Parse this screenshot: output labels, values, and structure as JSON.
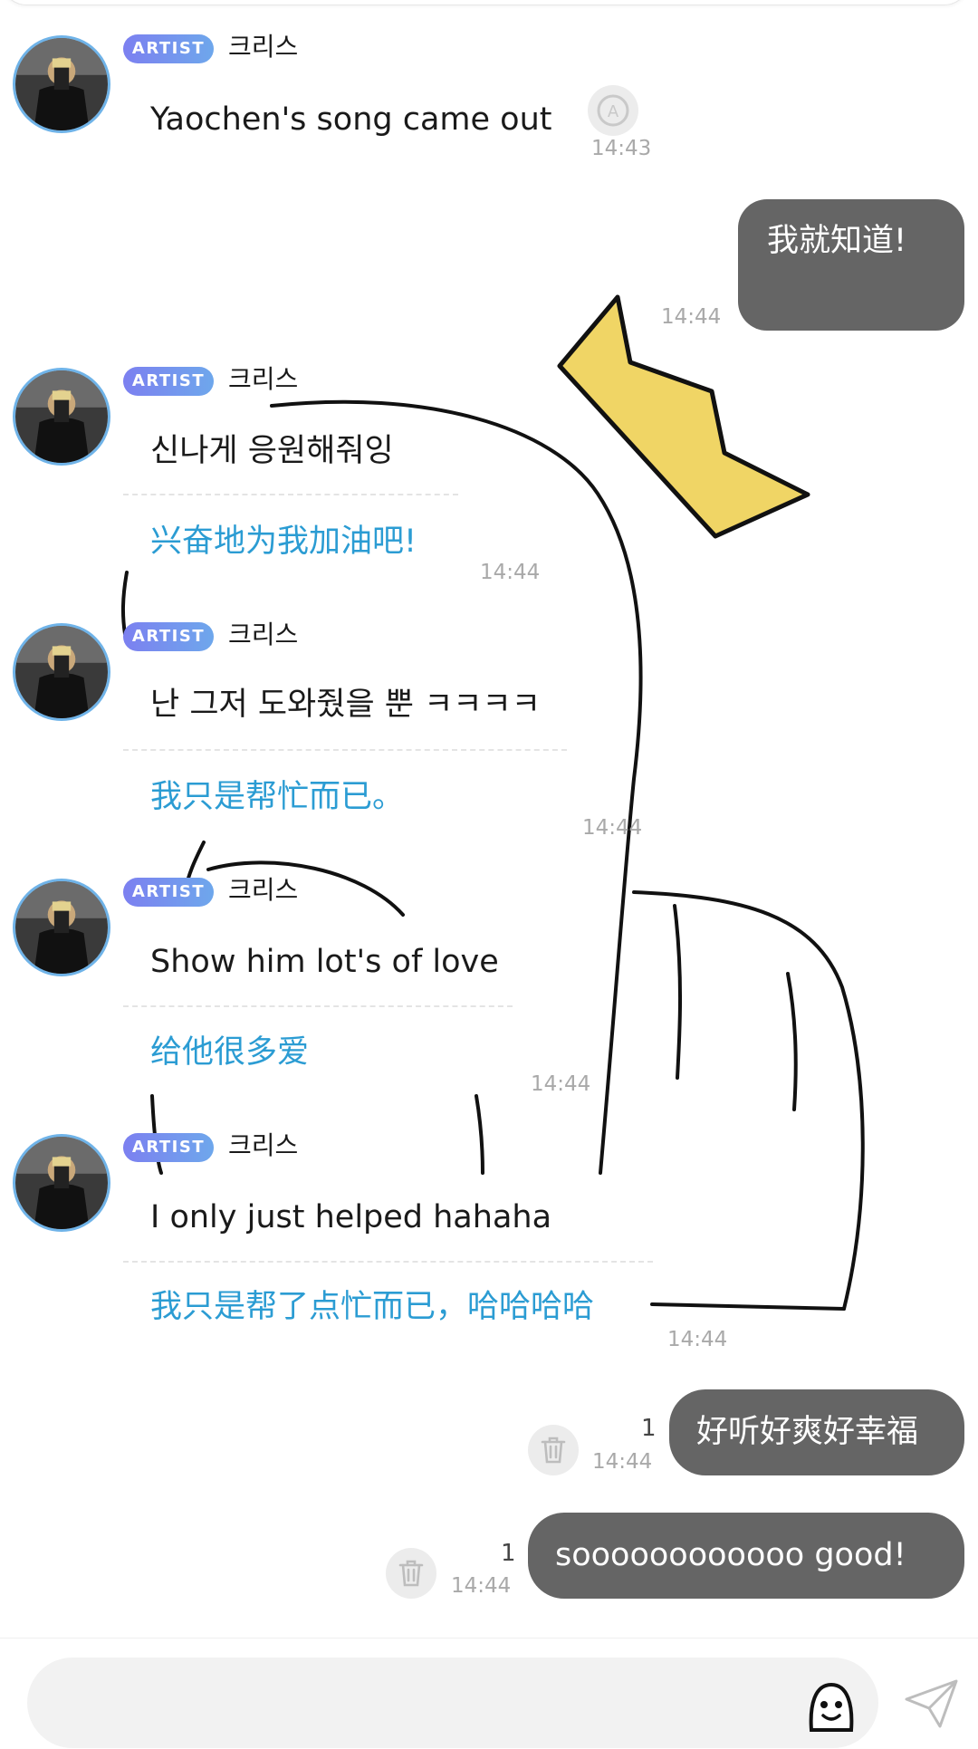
{
  "messages": [
    {
      "type": "artist",
      "badge": "ARTIST",
      "name": "크리스",
      "text": "Yaochen's song came out",
      "translation": "",
      "time": "14:43"
    },
    {
      "type": "me",
      "text": "我就知道!",
      "time": "14:44"
    },
    {
      "type": "artist",
      "badge": "ARTIST",
      "name": "크리스",
      "text": "신나게 응원해줘잉",
      "translation": "兴奋地为我加油吧!",
      "time": "14:44"
    },
    {
      "type": "artist",
      "badge": "ARTIST",
      "name": "크리스",
      "text": "난 그저 도와줬을 뿐 ㅋㅋㅋㅋ",
      "translation": "我只是帮忙而已。",
      "time": "14:44"
    },
    {
      "type": "artist",
      "badge": "ARTIST",
      "name": "크리스",
      "text": "Show him lot's of love",
      "translation": "给他很多爱",
      "time": "14:44"
    },
    {
      "type": "artist",
      "badge": "ARTIST",
      "name": "크리스",
      "text": "I only just helped hahaha",
      "translation": "我只是帮了点忙而已，哈哈哈哈",
      "time": "14:44"
    },
    {
      "type": "me",
      "text": "好听好爽好幸福",
      "time": "14:44",
      "unread": "1"
    },
    {
      "type": "me",
      "text": "soooooooooooo good!",
      "time": "14:44",
      "unread": "1"
    }
  ],
  "icons": {
    "translate": "translate-icon",
    "delete": "trash-icon",
    "emoji": "emoji-icon",
    "send": "send-icon"
  },
  "colors": {
    "badge": "#7c80f0",
    "translation": "#2b9cd3",
    "bubble": "#656565",
    "crown": "#f0d565"
  }
}
